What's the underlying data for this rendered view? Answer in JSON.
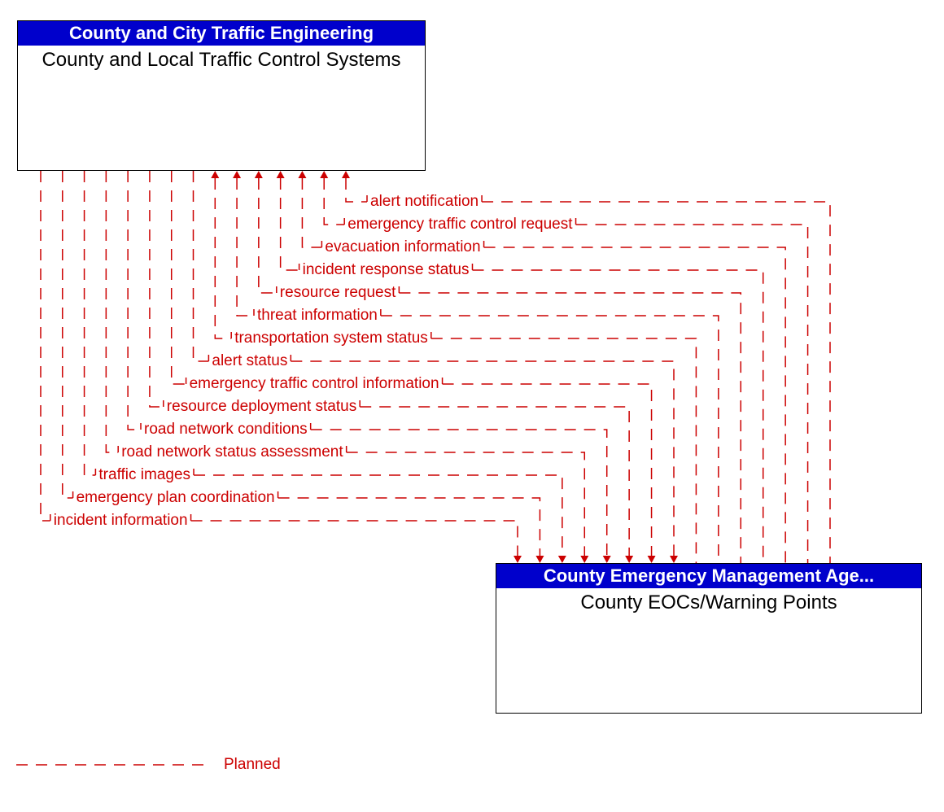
{
  "boxes": {
    "top": {
      "header": "County and City Traffic Engineering",
      "title": "County and Local Traffic Control Systems"
    },
    "bottom": {
      "header": "County Emergency Management Age...",
      "title": "County EOCs/Warning Points"
    }
  },
  "flows_to_top": [
    "alert notification",
    "emergency traffic control request",
    "evacuation information",
    "incident response status",
    "resource request",
    "threat information",
    "transportation system status"
  ],
  "flows_to_bottom": [
    "alert status",
    "emergency traffic control information",
    "resource deployment status",
    "road network conditions",
    "road network status assessment",
    "traffic images",
    "emergency plan coordination",
    "incident information"
  ],
  "legend": {
    "planned": "Planned"
  },
  "colors": {
    "planned": "#cc0000",
    "header_bg": "#0000cc"
  }
}
